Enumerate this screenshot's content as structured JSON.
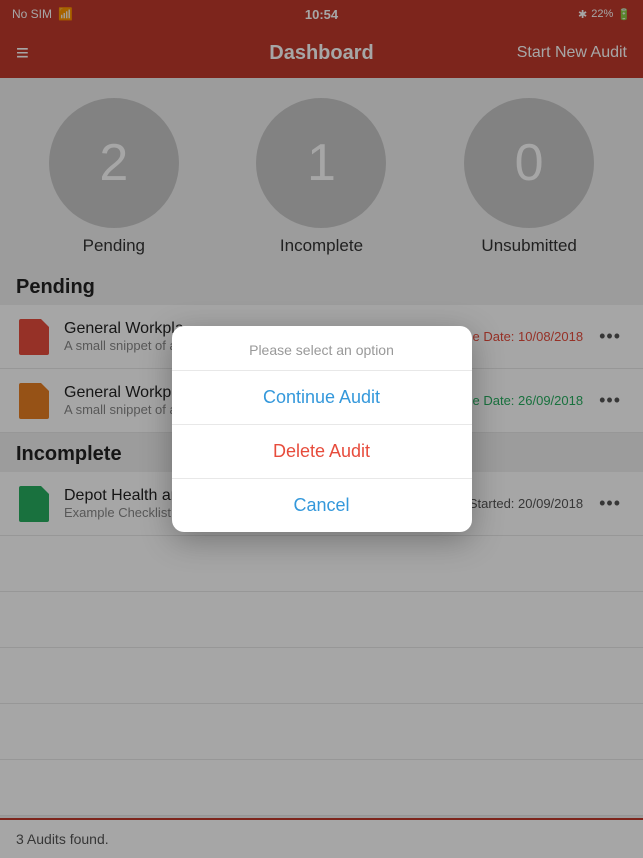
{
  "statusBar": {
    "carrier": "No SIM",
    "wifi": "wifi",
    "time": "10:54",
    "bluetooth": "BT",
    "battery": "22%"
  },
  "header": {
    "menuIcon": "≡",
    "title": "Dashboard",
    "action": "Start New Audit"
  },
  "stats": [
    {
      "value": "2",
      "label": "Pending"
    },
    {
      "value": "1",
      "label": "Incomplete"
    },
    {
      "value": "0",
      "label": "Unsubmitted"
    }
  ],
  "sections": [
    {
      "title": "Pending",
      "items": [
        {
          "iconColor": "red",
          "title": "General Workpla...",
          "subtitle": "A small snippet of a gene...",
          "dateLabel": "e Date: 10/08/2018",
          "dateStyle": "red"
        },
        {
          "iconColor": "orange",
          "title": "General Workpla...",
          "subtitle": "A small snippet of a gene...",
          "dateLabel": "e Date: 26/09/2018",
          "dateStyle": "green"
        }
      ]
    },
    {
      "title": "Incomplete",
      "items": [
        {
          "iconColor": "green",
          "title": "Depot Health and Safety",
          "subtitle": "Example Checklist",
          "dateLabel": "Started: 20/09/2018",
          "dateStyle": "dark"
        }
      ]
    }
  ],
  "actionSheet": {
    "title": "Please select an option",
    "options": [
      {
        "label": "Continue Audit",
        "style": "blue"
      },
      {
        "label": "Delete Audit",
        "style": "blue"
      },
      {
        "label": "Cancel",
        "style": "blue"
      }
    ]
  },
  "footer": {
    "text": "3 Audits found."
  }
}
